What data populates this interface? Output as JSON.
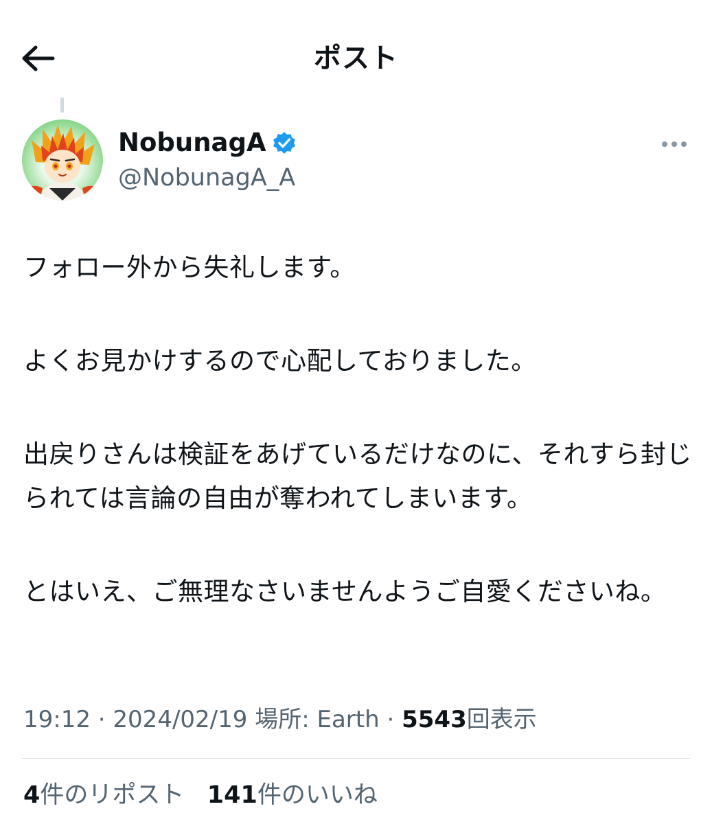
{
  "header": {
    "title": "ポスト",
    "back_icon": "arrow-left-icon"
  },
  "author": {
    "display_name": "NobunagA",
    "handle": "@NobunagA_A",
    "verified_icon": "verified-badge-icon",
    "verified_color": "#1d9bf0",
    "more_icon": "more-horizontal-icon"
  },
  "post": {
    "paragraphs": [
      "フォロー外から失礼します。",
      "よくお見かけするので心配しておりました。",
      "出戻りさんは検証をあげているだけなのに、それすら封じられては言論の自由が奪われてしまいます。",
      "とはいえ、ご無理なさいませんようご自愛くださいね。"
    ]
  },
  "meta": {
    "time": "19:12",
    "date": "2024/02/19",
    "location_label": "場所:",
    "location": "Earth",
    "separator": "·",
    "views_count": "5543",
    "views_label": "回表示"
  },
  "stats": {
    "reposts_count": "4",
    "reposts_label": "件のリポスト",
    "likes_count": "141",
    "likes_label": "件のいいね"
  },
  "colors": {
    "text_primary": "#0f1419",
    "text_secondary": "#536471",
    "divider": "#e1e6ea",
    "accent": "#1d9bf0"
  }
}
